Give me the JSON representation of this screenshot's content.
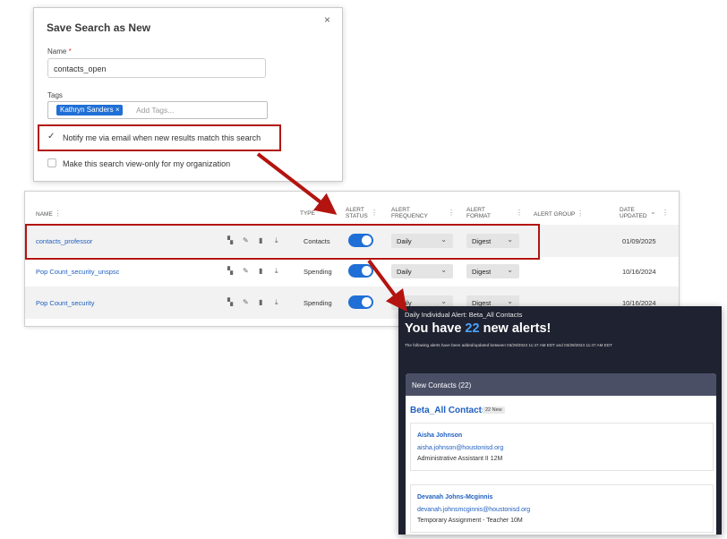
{
  "dialog": {
    "title": "Save Search as New",
    "close": "×",
    "name_label": "Name",
    "required_mark": "*",
    "name_value": "contacts_open",
    "tags_label": "Tags",
    "tag_chip": "Kathryn Sanders ×",
    "tags_placeholder": "Add Tags...",
    "notify_check": "✓",
    "notify_label": "Notify me via email when new results match this search",
    "viewonly_label": "Make this search view-only for my organization"
  },
  "table": {
    "headers": {
      "name": "NAME",
      "type": "TYPE",
      "alert_status_1": "ALERT",
      "alert_status_2": "STATUS",
      "alert_freq_1": "ALERT",
      "alert_freq_2": "FREQUENCY",
      "alert_format_1": "ALERT",
      "alert_format_2": "FORMAT",
      "alert_group": "ALERT GROUP",
      "date_1": "DATE",
      "date_2": "UPDATED",
      "menu": "⋮",
      "sort": "⌄"
    },
    "rows": [
      {
        "name": "contacts_professor",
        "type": "Contacts",
        "frequency": "Daily",
        "format": "Digest",
        "date": "01/09/2025"
      },
      {
        "name": "Pop Count_security_unspsc",
        "type": "Spending",
        "frequency": "Daily",
        "format": "Digest",
        "date": "10/16/2024"
      },
      {
        "name": "Pop Count_security",
        "type": "Spending",
        "frequency": "Daily",
        "format": "Digest",
        "date": "10/16/2024"
      }
    ],
    "icons": {
      "copy": "▚",
      "edit": "✎",
      "delete": "▮",
      "download": "⤓",
      "chevron": "⌄"
    }
  },
  "email": {
    "header": "Daily Individual Alert: Beta_All Contacts",
    "big_prefix": "You have ",
    "big_count": "22",
    "big_suffix": " new alerts!",
    "subtext": "The following alerts have been added/updated between 03/29/2024 11:47 AM EDT and 03/29/2024 11:47 AM EDT",
    "section_title": "New Contacts (22)",
    "group_title": "Beta_All Contacts",
    "group_badge": "22 New",
    "contacts": [
      {
        "name": "Aisha Johnson",
        "email": "aisha.johnson@houstonisd.org",
        "title": "Administrative Assistant II 12M"
      },
      {
        "name": "Devanah Johns-Mcginnis",
        "email": "devanah.johnsmcginnis@houstonisd.org",
        "title": "Temporary Assignment - Teacher 10M"
      }
    ]
  },
  "colors": {
    "accent": "#1f6fd6",
    "highlight": "#b3140f",
    "email_bg": "#1f2230"
  }
}
